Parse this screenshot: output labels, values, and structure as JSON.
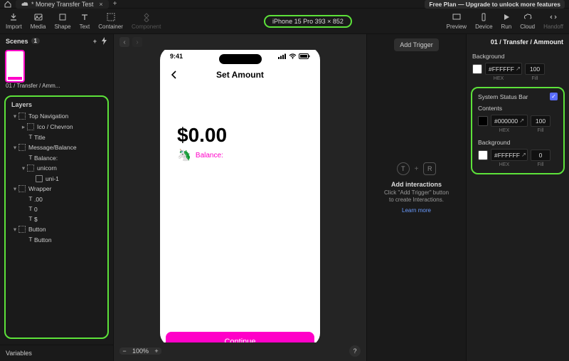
{
  "topbar": {
    "tab_title": "* Money Transfer Test",
    "free_plan": "Free Plan — Upgrade to unlock more features"
  },
  "toolbar": {
    "items": [
      "Import",
      "Media",
      "Shape",
      "Text",
      "Container",
      "Component"
    ],
    "device_badge": "iPhone 15 Pro  393 × 852",
    "right_items": [
      "Preview",
      "Device",
      "Run",
      "Cloud",
      "Handoff"
    ]
  },
  "scenes": {
    "title": "Scenes",
    "count": "1",
    "thumb_caption": "01 / Transfer / Amm..."
  },
  "layers": {
    "title": "Layers",
    "rows": [
      {
        "label": "Top Navigation"
      },
      {
        "label": "Ico / Chevron"
      },
      {
        "label": "Title"
      },
      {
        "label": "Message/Balance"
      },
      {
        "label": "Balance:"
      },
      {
        "label": "unicorn"
      },
      {
        "label": "uni-1"
      },
      {
        "label": "Wrapper"
      },
      {
        "label": ".00"
      },
      {
        "label": "0"
      },
      {
        "label": "$"
      },
      {
        "label": "Button"
      },
      {
        "label": "Button"
      }
    ]
  },
  "variables": {
    "label": "Variables"
  },
  "canvas": {
    "zoom": "100%",
    "phone": {
      "time": "9:41",
      "title": "Set Amount",
      "amount": "$0.00",
      "balance_label": "Balance:",
      "continue": "Continue"
    }
  },
  "midpanel": {
    "add_trigger": "Add Trigger",
    "heading": "Add interactions",
    "sub1": "Click \"Add Trigger\" button",
    "sub2": "to create Interactions.",
    "learn_more": "Learn more"
  },
  "right": {
    "header": "01 / Transfer / Ammount",
    "background_label": "Background",
    "bg_hex": "#FFFFFF",
    "bg_fill": "100",
    "hex_label": "HEX",
    "fill_label": "Fill",
    "status_section": {
      "title": "System Status Bar",
      "contents_label": "Contents",
      "contents_hex": "#000000",
      "contents_fill": "100",
      "background_label": "Background",
      "background_hex": "#FFFFFF",
      "background_fill": "0"
    }
  }
}
